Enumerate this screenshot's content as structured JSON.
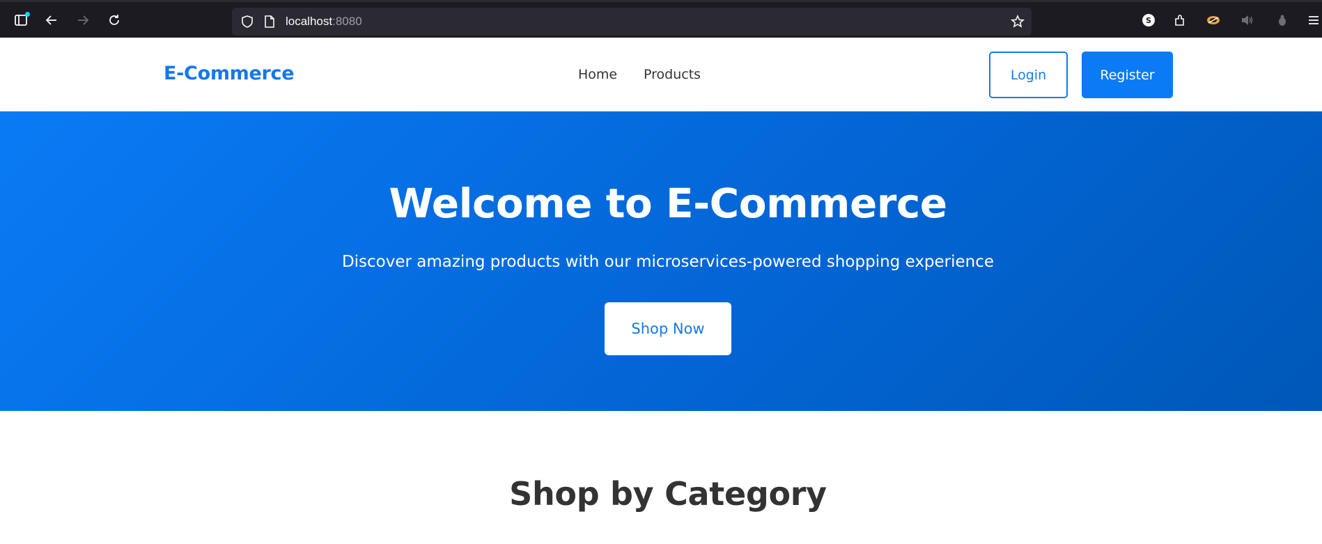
{
  "browser": {
    "url_host": "localhost",
    "url_port": ":8080",
    "icons": [
      "sidebar-icon",
      "back-icon",
      "forward-icon",
      "reload-icon",
      "shield-icon",
      "page-icon",
      "bookmark-star-icon",
      "account-icon",
      "extensions-icon",
      "extension-icon",
      "speaker-icon",
      "extension-icon-2",
      "menu-icon"
    ]
  },
  "header": {
    "brand": "E-Commerce",
    "nav": [
      {
        "label": "Home"
      },
      {
        "label": "Products"
      }
    ],
    "login_label": "Login",
    "register_label": "Register"
  },
  "hero": {
    "title": "Welcome to E-Commerce",
    "subtitle": "Discover amazing products with our microservices-powered shopping experience",
    "cta_label": "Shop Now"
  },
  "categories": {
    "title": "Shop by Category"
  },
  "colors": {
    "accent": "#1479e8",
    "hero_start": "#0a7bf5",
    "hero_end": "#0058b8",
    "browser_bg": "#1c1b22"
  }
}
